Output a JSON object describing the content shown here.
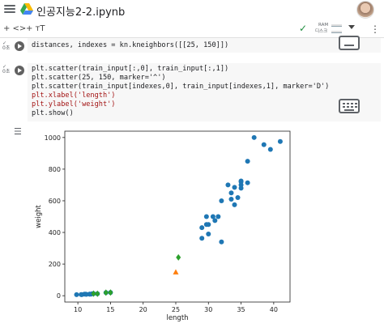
{
  "header": {
    "title": "인공지능2-2.ipynb",
    "icons": {
      "menu": "menu-icon",
      "drive": "google-drive-icon",
      "avatar": "user-avatar"
    }
  },
  "toolbar": {
    "add_code": "+ <>",
    "add_text": "+ ᴛT",
    "ram_label": "RAM",
    "disk_label": "디스크",
    "status_icon": "check-icon",
    "colors": {
      "check": "#1e8e3e"
    }
  },
  "cells": [
    {
      "status": "✓\n0초",
      "lines": [
        "distances, indexes = kn.kneighbors([[25, 150]])"
      ]
    },
    {
      "status": "✓\n0초",
      "lines": [
        "plt.scatter(train_input[:,0], train_input[:,1])",
        "plt.scatter(25, 150, marker='^')",
        "plt.scatter(train_input[indexes,0], train_input[indexes,1], marker='D')",
        "plt.xlabel('length')",
        "plt.ylabel('weight')",
        "plt.show()"
      ]
    }
  ],
  "output_icon": "output-settings-icon",
  "chart_data": {
    "type": "scatter",
    "xlabel": "length",
    "ylabel": "weight",
    "xlim": [
      8,
      42.5
    ],
    "ylim": [
      -40,
      1040
    ],
    "xticks": [
      10,
      15,
      20,
      25,
      30,
      35,
      40
    ],
    "yticks": [
      0,
      200,
      400,
      600,
      800,
      1000
    ],
    "series": [
      {
        "marker": "circle",
        "color": "#1f77b4",
        "points": [
          [
            9.8,
            6.7
          ],
          [
            10.5,
            7.5
          ],
          [
            10.6,
            7.0
          ],
          [
            11.0,
            9.7
          ],
          [
            11.2,
            9.8
          ],
          [
            11.3,
            8.7
          ],
          [
            11.8,
            10.0
          ],
          [
            11.8,
            9.9
          ],
          [
            12.0,
            9.8
          ],
          [
            12.2,
            12.2
          ],
          [
            12.4,
            13.4
          ],
          [
            13.0,
            12.2
          ],
          [
            14.3,
            19.7
          ],
          [
            15.0,
            19.9
          ],
          [
            29.0,
            430
          ],
          [
            29.0,
            363
          ],
          [
            29.7,
            500
          ],
          [
            29.7,
            450
          ],
          [
            30.0,
            390
          ],
          [
            30.0,
            450
          ],
          [
            30.7,
            500
          ],
          [
            31.0,
            475
          ],
          [
            31.5,
            500
          ],
          [
            32.0,
            340
          ],
          [
            32.0,
            600
          ],
          [
            33.0,
            700
          ],
          [
            33.5,
            610
          ],
          [
            33.5,
            650
          ],
          [
            34.0,
            575
          ],
          [
            34.0,
            685
          ],
          [
            34.5,
            620
          ],
          [
            35.0,
            680
          ],
          [
            35.0,
            700
          ],
          [
            35.0,
            725
          ],
          [
            35.0,
            720
          ],
          [
            36.0,
            714
          ],
          [
            36.0,
            850
          ],
          [
            37.0,
            1000
          ],
          [
            38.5,
            955
          ],
          [
            39.5,
            925
          ],
          [
            41.0,
            975
          ]
        ]
      },
      {
        "marker": "triangle",
        "color": "#ff7f0e",
        "points": [
          [
            25,
            150
          ]
        ]
      },
      {
        "marker": "diamond",
        "color": "#2ca02c",
        "points": [
          [
            25.4,
            242
          ],
          [
            15.0,
            19.9
          ],
          [
            14.3,
            19.7
          ],
          [
            13.0,
            12.2
          ],
          [
            12.4,
            13.4
          ]
        ]
      }
    ]
  }
}
